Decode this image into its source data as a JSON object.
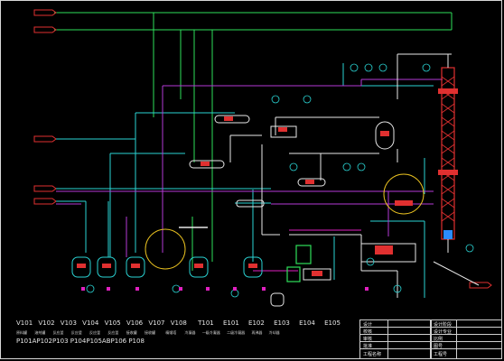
{
  "legend": {
    "equipment_tags": [
      "V101",
      "V102",
      "V103",
      "V104",
      "V105",
      "V106",
      "V107",
      "V108",
      "T101",
      "E101",
      "E102",
      "E103",
      "E104",
      "E105"
    ],
    "pump_tags": "P101AP102P103   P104P105ABP106   P108",
    "subtitles": [
      "原料罐",
      "溶剂罐",
      "反应釜",
      "反应釜",
      "反应釜",
      "反应釜",
      "接收罐",
      "接收罐",
      "精馏塔",
      "冷凝器",
      "一级冷凝器",
      "二级冷凝器",
      "再沸器",
      "冷却器"
    ]
  },
  "title_block": {
    "left_rows": [
      "设计",
      "校核",
      "审核",
      "批准",
      "工程名称"
    ],
    "right_rows": [
      "设计阶段",
      "设计专业",
      "比例",
      "图号",
      "工程号"
    ]
  },
  "colors": {
    "background": "#000000",
    "green": "#2ee05a",
    "cyan": "#2ad4d4",
    "purple": "#b43ad6",
    "magenta": "#e020c0",
    "red": "#e03030",
    "white": "#e8e8e8",
    "yellow": "#e8c020",
    "blue": "#2a8cff"
  }
}
